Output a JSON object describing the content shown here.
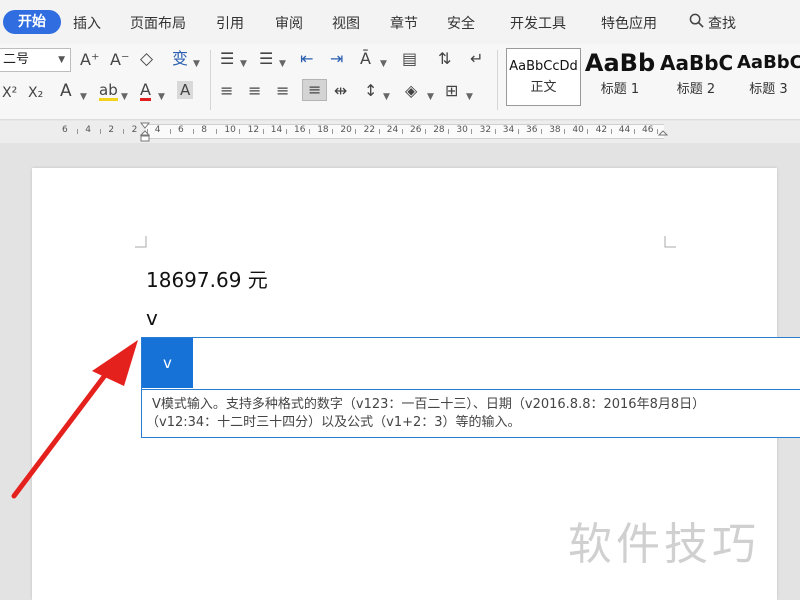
{
  "menu": {
    "items": [
      "开始",
      "插入",
      "页面布局",
      "引用",
      "审阅",
      "视图",
      "章节",
      "安全",
      "开发工具",
      "特色应用"
    ],
    "search_label": "查找",
    "accent": "#2f6de1"
  },
  "ribbon": {
    "font_size_value": "二号",
    "style_gallery": [
      {
        "sample": "AaBbCcDd",
        "name": "正文"
      },
      {
        "sample": "AaBb",
        "name": "标题 1"
      },
      {
        "sample": "AaBbC",
        "name": "标题 2"
      },
      {
        "sample": "AaBbC",
        "name": "标题 3"
      }
    ]
  },
  "ruler": {
    "labels": [
      "6",
      "4",
      "2",
      "2",
      "4",
      "6",
      "8",
      "10",
      "12",
      "14",
      "16",
      "18",
      "20",
      "22",
      "24",
      "26",
      "28",
      "30",
      "32",
      "34",
      "36",
      "38",
      "40",
      "42",
      "44",
      "46"
    ]
  },
  "document": {
    "line1": "18697.69 元",
    "line2": "v"
  },
  "v_mode_popup": {
    "candidate": "v",
    "hint_line1": "V模式输入。支持多种格式的数字（v123：一百二十三）、日期（v2016.8.8：2016年8月8日）",
    "hint_line2": "（v12:34：十二时三十四分）以及公式（v1+2：3）等的输入。",
    "highlight_color": "#1672d6"
  },
  "watermark": "软件技巧",
  "annotation_arrow_color": "#e5211d"
}
